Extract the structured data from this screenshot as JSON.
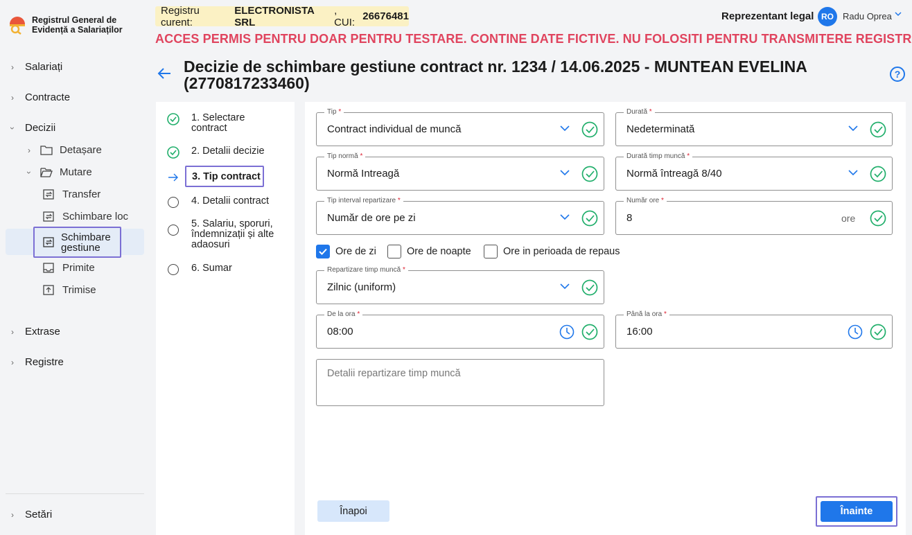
{
  "app": {
    "logo_line1": "Registrul General de",
    "logo_line2": "Evidență a Salariaților"
  },
  "header": {
    "registry_prefix": "Registru curent: ",
    "company": "ELECTRONISTA SRL",
    "cui_prefix": ", CUI: ",
    "cui": "26676481",
    "warning": "ACCES PERMIS PENTRU DOAR PENTRU TESTARE. CONTINE DATE FICTIVE. NU FOLOSITI PENTRU TRANSMITERE REGISTRU",
    "rep_label": "Reprezentant legal",
    "avatar_initials": "RO",
    "user_name": "Radu Oprea"
  },
  "sidebar": {
    "salariati": "Salariați",
    "contracte": "Contracte",
    "decizii": "Decizii",
    "detasare": "Detașare",
    "mutare": "Mutare",
    "transfer": "Transfer",
    "schimbare_loc": "Schimbare loc",
    "schimbare_gestiune_1": "Schimbare",
    "schimbare_gestiune_2": "gestiune",
    "primite": "Primite",
    "trimise": "Trimise",
    "extrase": "Extrase",
    "registre": "Registre",
    "setari": "Setări"
  },
  "page": {
    "title": "Decizie de schimbare gestiune contract nr. 1234 / 14.06.2025 - MUNTEAN EVELINA (2770817233460)",
    "help": "?"
  },
  "steps": {
    "s1": "1. Selectare contract",
    "s2": "2. Detalii decizie",
    "s3": "3. Tip contract",
    "s4": "4. Detalii contract",
    "s5": "5. Salariu, sporuri, îndemnizații și alte adaosuri",
    "s6": "6. Sumar"
  },
  "form": {
    "tip": {
      "label": "Tip",
      "value": "Contract individual de muncă"
    },
    "durata": {
      "label": "Durată",
      "value": "Nedeterminată"
    },
    "tip_norma": {
      "label": "Tip normă",
      "value": "Normă Intreagă"
    },
    "durata_timp": {
      "label": "Durată timp muncă",
      "value": "Normă întreagă 8/40"
    },
    "tip_interval": {
      "label": "Tip interval repartizare",
      "value": "Număr de ore pe zi"
    },
    "numar_ore": {
      "label": "Număr ore",
      "value": "8",
      "unit": "ore"
    },
    "cb_zi": {
      "label": "Ore de zi",
      "checked": true
    },
    "cb_noapte": {
      "label": "Ore de noapte",
      "checked": false
    },
    "cb_repaus": {
      "label": "Ore in perioada de repaus",
      "checked": false
    },
    "repartizare": {
      "label": "Repartizare timp muncă",
      "value": "Zilnic (uniform)"
    },
    "de_la": {
      "label": "De la ora",
      "value": "08:00"
    },
    "pana_la": {
      "label": "Până la ora",
      "value": "16:00"
    },
    "detalii_placeholder": "Detalii repartizare timp muncă",
    "required_mark": "*"
  },
  "buttons": {
    "back": "Înapoi",
    "next": "Înainte"
  },
  "colors": {
    "accent": "#1f77ea",
    "ok": "#1fae6a",
    "warning": "#e0445e",
    "highlight": "#7b6fd4"
  }
}
